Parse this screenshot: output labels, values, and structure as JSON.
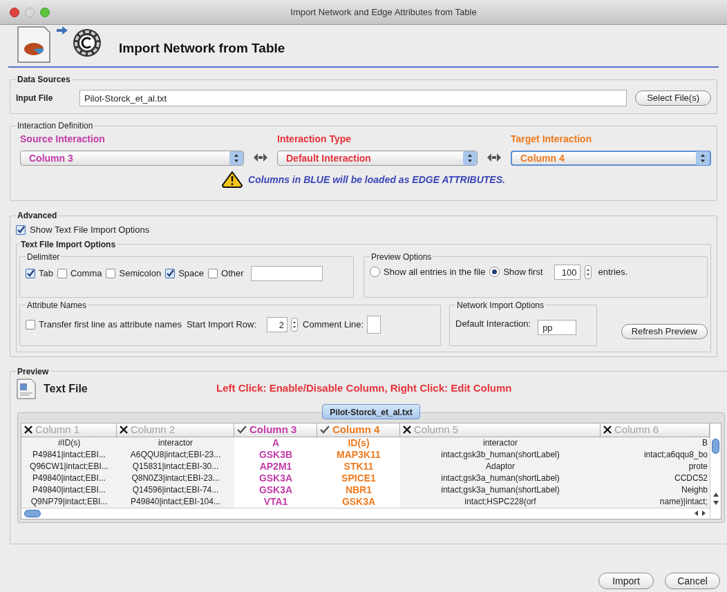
{
  "window": {
    "title": "Import Network and Edge Attributes from Table"
  },
  "header": {
    "title": "Import Network from Table"
  },
  "data_sources": {
    "legend": "Data Sources",
    "input_label": "Input File",
    "input_value": "Pilot-Storck_et_al.txt",
    "select_button": "Select File(s)"
  },
  "interaction_definition": {
    "legend": "Interaction Definition",
    "selectors": [
      {
        "label": "Source Interaction",
        "value": "Column 3",
        "color": "#c23aa8",
        "focused": false
      },
      {
        "label": "Interaction Type",
        "value": "Default Interaction",
        "color": "#e5323a",
        "focused": false
      },
      {
        "label": "Target Interaction",
        "value": "Column 4",
        "color": "#ee7a1e",
        "focused": true
      }
    ],
    "note": "Columns in BLUE will be loaded as EDGE ATTRIBUTES."
  },
  "advanced": {
    "legend": "Advanced",
    "show_options": {
      "label": "Show Text File Import Options",
      "checked": true
    },
    "text_file_options": {
      "legend": "Text File Import Options",
      "delimiter": {
        "legend": "Delimiter",
        "options": [
          {
            "label": "Tab",
            "checked": true
          },
          {
            "label": "Comma",
            "checked": false
          },
          {
            "label": "Semicolon",
            "checked": false
          },
          {
            "label": "Space",
            "checked": true
          },
          {
            "label": "Other",
            "checked": false
          }
        ]
      },
      "preview_options": {
        "legend": "Preview Options",
        "options": [
          {
            "label": "Show all entries in the file",
            "selected": false
          },
          {
            "label": "Show first",
            "selected": true
          }
        ],
        "count": "100",
        "suffix": "entries."
      },
      "attribute_names": {
        "legend": "Attribute Names",
        "transfer": {
          "label": "Transfer first line as attribute names",
          "checked": false
        },
        "start_row_label": "Start Import Row:",
        "start_row_value": "2",
        "comment_label": "Comment Line:"
      },
      "network_import": {
        "legend": "Network Import Options",
        "default_label": "Default Interaction:",
        "default_value": "pp"
      },
      "refresh_button": "Refresh Preview"
    }
  },
  "preview": {
    "legend": "Preview",
    "title": "Text File",
    "instruction": "Left Click: Enable/Disable Column, Right Click: Edit Column",
    "file_tab": "Pilot-Storck_et_al.txt",
    "columns": [
      {
        "name": "Column 1",
        "enabled": false
      },
      {
        "name": "Column 2",
        "enabled": false
      },
      {
        "name": "Column 3",
        "enabled": true,
        "color": "#c23aa8"
      },
      {
        "name": "Column 4",
        "enabled": true,
        "color": "#ee7a1e"
      },
      {
        "name": "Column 5",
        "enabled": false
      },
      {
        "name": "Column 6",
        "enabled": false
      }
    ],
    "rows": [
      [
        "#ID(s)",
        "interactor",
        "A",
        "ID(s)",
        "interactor",
        "B"
      ],
      [
        "P49841|intact;EBI...",
        "A6QQU8|intact;EBI-23...",
        "GSK3B",
        "MAP3K11",
        "intact;gsk3b_human(shortLabel)",
        "intact;a6qqu8_bo"
      ],
      [
        "Q96CW1|intact;EBI...",
        "Q15831|intact;EBI-30...",
        "AP2M1",
        "STK11",
        "Adaptor",
        "prote"
      ],
      [
        "P49840|intact;EBI...",
        "Q8N0Z3|intact;EBI-23...",
        "GSK3A",
        "SPICE1",
        "intact;gsk3a_human(shortLabel)",
        "CCDC52"
      ],
      [
        "P49840|intact;EBI...",
        "Q14596|intact;EBI-74...",
        "GSK3A",
        "NBR1",
        "intact;gsk3a_human(shortLabel)",
        "Neighb"
      ],
      [
        "Q9NP79|intact;EBI...",
        "P49840|intact;EBI-104...",
        "VTA1",
        "GSK3A",
        "intact;HSPC228(orf",
        "name)|intact;"
      ]
    ]
  },
  "buttons": [
    {
      "label": "Import"
    },
    {
      "label": "Cancel"
    }
  ]
}
